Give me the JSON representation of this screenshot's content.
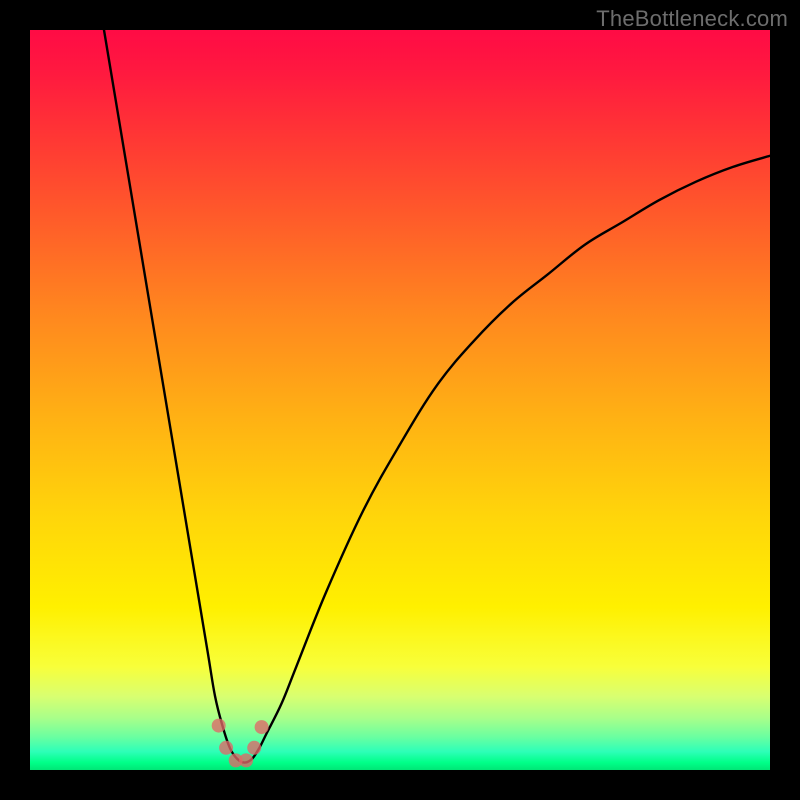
{
  "watermark": "TheBottleneck.com",
  "chart_data": {
    "type": "line",
    "title": "",
    "xlabel": "",
    "ylabel": "",
    "xlim": [
      0,
      100
    ],
    "ylim": [
      0,
      100
    ],
    "series": [
      {
        "name": "curve",
        "x": [
          10,
          12,
          14,
          16,
          18,
          20,
          22,
          24,
          25,
          26,
          27,
          28,
          29,
          30,
          31,
          32,
          34,
          36,
          40,
          45,
          50,
          55,
          60,
          65,
          70,
          75,
          80,
          85,
          90,
          95,
          100
        ],
        "y": [
          100,
          88,
          76,
          64,
          52,
          40,
          28,
          16,
          10,
          6,
          3,
          1.5,
          1,
          1.5,
          3,
          5,
          9,
          14,
          24,
          35,
          44,
          52,
          58,
          63,
          67,
          71,
          74,
          77,
          79.5,
          81.5,
          83
        ]
      }
    ],
    "markers": {
      "x": [
        25.5,
        26.5,
        27.8,
        29.2,
        30.3,
        31.3
      ],
      "y": [
        6,
        3,
        1.3,
        1.3,
        3,
        5.8
      ]
    },
    "gradient_stops": [
      {
        "pos": 0.0,
        "color": "#ff0b45"
      },
      {
        "pos": 0.5,
        "color": "#ffb014"
      },
      {
        "pos": 0.8,
        "color": "#fff000"
      },
      {
        "pos": 1.0,
        "color": "#00e676"
      }
    ]
  }
}
